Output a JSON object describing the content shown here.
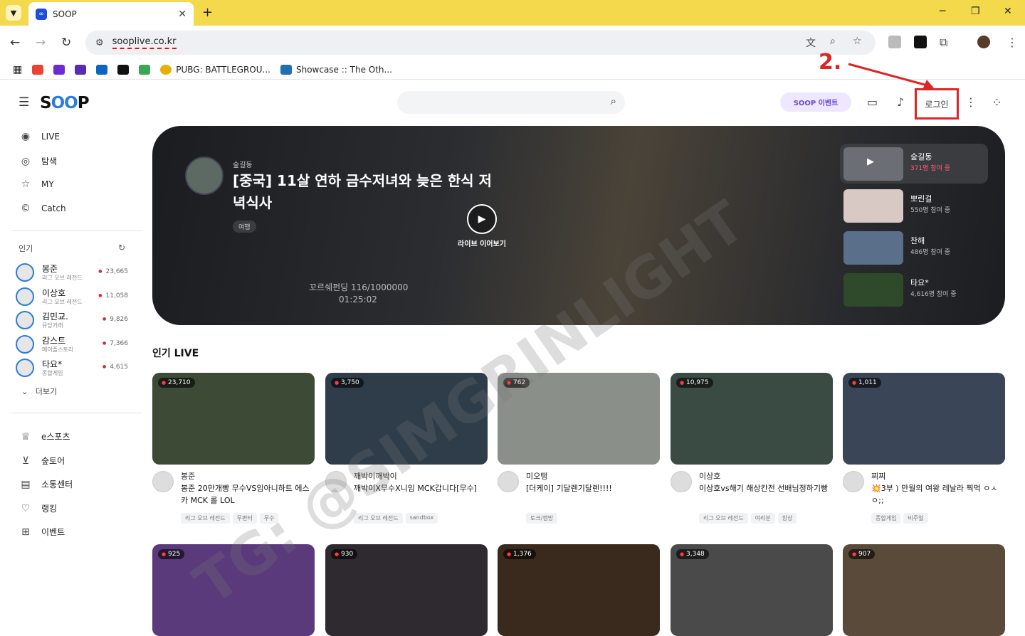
{
  "browser": {
    "tab_title": "SOOP",
    "url": "sooplive.co.kr",
    "bookmarks": [
      "PUBG: BATTLEGROU...",
      "Showcase :: The Oth..."
    ]
  },
  "header": {
    "logo": "SOOP",
    "event_label": "SOOP 이벤트",
    "login_label": "로그인",
    "annotation": "2."
  },
  "sidebar": {
    "nav": [
      {
        "label": "LIVE",
        "icon": "live-icon"
      },
      {
        "label": "탐색",
        "icon": "compass-icon"
      },
      {
        "label": "MY",
        "icon": "star-icon"
      },
      {
        "label": "Catch",
        "icon": "catch-icon"
      }
    ],
    "popular_title": "인기",
    "popular": [
      {
        "name": "봉준",
        "category": "리그 오브 레전드",
        "viewers": "23,665"
      },
      {
        "name": "이상호",
        "category": "리그 오브 레전드",
        "viewers": "11,058"
      },
      {
        "name": "김민교.",
        "category": "뮤당거래",
        "viewers": "9,826"
      },
      {
        "name": "감스트",
        "category": "메이플스토리",
        "viewers": "7,366"
      },
      {
        "name": "타요*",
        "category": "종합게임",
        "viewers": "4,615"
      }
    ],
    "more_label": "더보기",
    "links": [
      {
        "label": "e스포츠",
        "icon": "trophy-icon"
      },
      {
        "label": "숲토어",
        "icon": "cart-icon"
      },
      {
        "label": "소통센터",
        "icon": "chat-icon"
      },
      {
        "label": "랭킹",
        "icon": "ranking-icon"
      },
      {
        "label": "이벤트",
        "icon": "gift-icon"
      }
    ]
  },
  "hero": {
    "channel": "숲길동",
    "title": "[중국] 11살 연하 금수저녀와 늦은 한식 저녁식사",
    "tag": "여행",
    "resume_label": "라이브 이어보기",
    "overlay_count": "꼬르쉐펀딩 116/1000000",
    "overlay_time": "01:25:02",
    "side_list": [
      {
        "name": "숲길동",
        "viewers": "371명 참여 중"
      },
      {
        "name": "뽀린걸",
        "viewers": "550명 참여 중"
      },
      {
        "name": "찬해",
        "viewers": "486명 참여 중"
      },
      {
        "name": "타요*",
        "viewers": "4,616명 참여 중"
      }
    ]
  },
  "popular_live": {
    "title": "인기 LIVE",
    "cards": [
      {
        "viewers": "23,710",
        "streamer": "봉준",
        "title": "봉준 20만개빵 무수VS임아니하트 에스카 MCK 롤 LOL",
        "tags": [
          "리그 오브 레전드",
          "무편터",
          "무수"
        ],
        "color": "#3c4a36"
      },
      {
        "viewers": "3,750",
        "streamer": "깨박이깨박이",
        "title": "깨박이X무수X니임 MCK갑니다[무수]",
        "tags": [
          "리그 오브 레전드",
          "sandbox"
        ],
        "color": "#2f3d4a"
      },
      {
        "viewers": "762",
        "streamer": "미오탱",
        "title": "[더케이] 기달렌기달렌!!!!",
        "tags": [
          "토크/캠방"
        ],
        "color": "#8a8f8a"
      },
      {
        "viewers": "10,975",
        "streamer": "이상호",
        "title": "이상호vs해기 해상칸전 선배님정하기빵",
        "tags": [
          "리그 오브 레전드",
          "여리분",
          "항상"
        ],
        "color": "#3a4b44"
      },
      {
        "viewers": "1,011",
        "streamer": "찌찌",
        "title": "💥3부 ) 만월의 여왕 레날라 찍먹 ㅇㅅㅇ;;",
        "tags": [
          "종합게임",
          "비주얼"
        ],
        "color": "#3a4658"
      }
    ],
    "row2": [
      {
        "viewers": "925",
        "color": "#5a3a7a"
      },
      {
        "viewers": "930",
        "color": "#2e2a30"
      },
      {
        "viewers": "1,376",
        "color": "#3a2a1e"
      },
      {
        "viewers": "3,348",
        "color": "#4a4a4a"
      },
      {
        "viewers": "907",
        "color": "#5a4a3a"
      }
    ]
  },
  "watermark": "TG: @SIMGRINLIGHT"
}
